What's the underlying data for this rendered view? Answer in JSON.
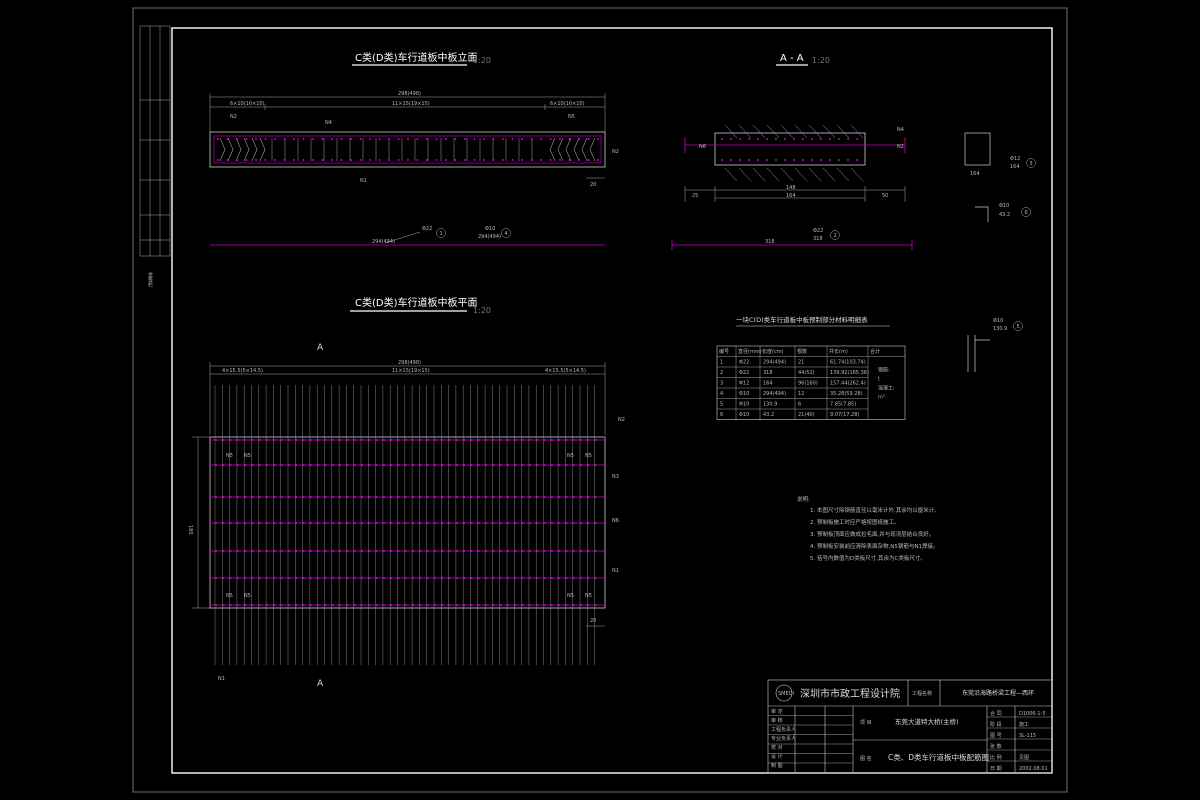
{
  "drawing": {
    "elevation_title": "C类(D类)车行道板中板立面",
    "elevation_scale": "1:20",
    "section_title": "A - A",
    "section_scale": "1:20",
    "plan_title": "C类(D类)车行道板中板平面",
    "plan_scale": "1:20",
    "section_mark": "A",
    "table_title": "一块C(D)类车行道板中板预制部分材料明细表",
    "table_headers": [
      "编号",
      "直径(mm)",
      "长度(cm)",
      "根数",
      "共长(m)",
      "合计"
    ],
    "table_rows": [
      [
        "1",
        "Φ22",
        "294(494)",
        "21",
        "61.74(103.74)"
      ],
      [
        "2",
        "Φ22",
        "318",
        "44(52)",
        "139.92(165.36)"
      ],
      [
        "3",
        "Φ12",
        "164",
        "96(160)",
        "157.44(262.4)"
      ],
      [
        "4",
        "Φ10",
        "294(494)",
        "12",
        "35.28(59.28)"
      ],
      [
        "5",
        "Φ10",
        "130.9",
        "6",
        "7.85(7.85)"
      ],
      [
        "6",
        "Φ10",
        "43.2",
        "21(40)",
        "9.07(17.28)"
      ]
    ],
    "table_total": [
      "钢筋:",
      "t",
      "混凝土:",
      "m³"
    ],
    "notes_header": "说明:",
    "notes": [
      "1. 本图尺寸除钢筋直径以毫米计外,其余均以厘米计。",
      "2. 预制板施工时应严格按图纸施工。",
      "3. 预制板顶面应做成拉毛面,并与现浇层结合良好。",
      "4. 预制板安装前应清除表面杂物,N5钢筋与N1焊接。",
      "5. 括号内数值为D类板尺寸,其余为C类板尺寸。"
    ],
    "company": "深圳市市政工程设计院",
    "project_label_1": "工程名称",
    "project_name": "东莞沿海路桥梁工程—西环",
    "project_label_2": "项 目",
    "project_sub": "东莞大道特大桥(主桥)",
    "drawing_label": "图 名",
    "drawing_name": "C类、D类车行道板中板配筋图",
    "staff_rows": [
      "审 定",
      "审 核",
      "工程负责人",
      "专业负责人",
      "校 对",
      "设 计",
      "制 图"
    ],
    "info_rows": [
      [
        "合 同",
        "D1006-1-5"
      ],
      [
        "阶 段",
        "施工"
      ],
      [
        "图 号",
        "SL-115"
      ],
      [
        "张 数",
        ""
      ],
      [
        "比 例",
        "见图"
      ],
      [
        "日 期",
        "2002.08.01"
      ]
    ],
    "left_strip": "会签栏",
    "dim_labels": {
      "total_length": "298(498)",
      "elev_left": "6×10(10×10)",
      "elev_mid": "11×15(19×15)",
      "elev_right": "6×10(10×10)",
      "plan_left": "4×15.5(5×14.5)",
      "plan_mid": "11×15(19×15)",
      "plan_right": "4×15.5(5×14.5)",
      "bar1": "Φ22",
      "bar1_len": "294(494)",
      "bar4": "Φ10",
      "bar4_len": "294(494)",
      "bar2": "Φ22",
      "bar2_len": "318",
      "bar3": "Φ12",
      "bar3_len": "164",
      "bar6": "Φ10",
      "bar6_len": "43.2",
      "bar5": "Φ10",
      "bar5_len": "130.9",
      "sec_w1": "25",
      "sec_w2": "148",
      "sec_w3": "164",
      "sec_w4": "50",
      "width_318": "318",
      "dim_20": "20",
      "height_180": "180",
      "n_labels": [
        "N1",
        "N2",
        "N3",
        "N4",
        "N5",
        "N6"
      ],
      "circle_ids": [
        "1",
        "2",
        "3",
        "4",
        "5",
        "6"
      ]
    }
  }
}
